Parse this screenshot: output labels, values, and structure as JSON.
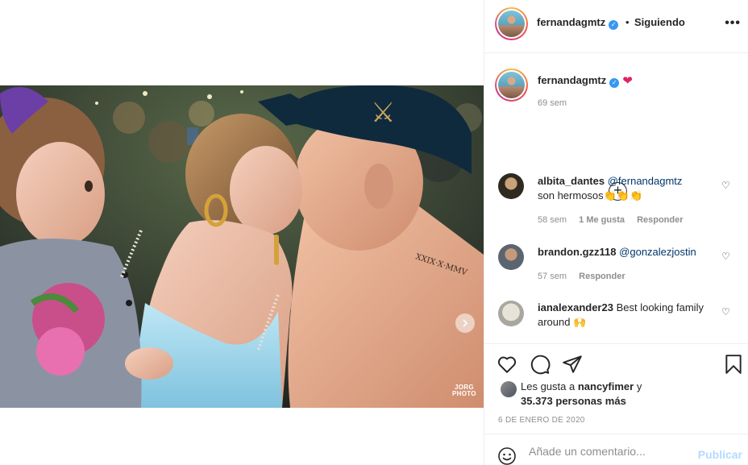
{
  "post": {
    "username": "fernandagmtz",
    "follow_status": "Siguiendo",
    "separator": "•",
    "more_icon": "more-horizontal-icon",
    "caption_emoji": "❤",
    "caption_time": "69 sem",
    "watermark_line1": "JORG",
    "watermark_line2": "PHOTO"
  },
  "comments": [
    {
      "username": "albita_dantes",
      "mention": "@fernandagmtz",
      "text": "son hermosos👏👏👏",
      "time": "58 sem",
      "likes": "1 Me gusta",
      "reply": "Responder"
    },
    {
      "username": "brandon.gzz118",
      "mention": "@gonzalezjostin",
      "text": "",
      "time": "57 sem",
      "reply": "Responder"
    },
    {
      "username": "ianalexander23",
      "text": "Best looking family around 🙌"
    }
  ],
  "likes": {
    "prefix": "Les gusta a",
    "user": "nancyfimer",
    "conjunction": "y",
    "others": "35.373 personas más"
  },
  "date": "6 DE ENERO DE 2020",
  "comment_box": {
    "placeholder": "Añade un comentario...",
    "post_label": "Publicar"
  },
  "colors": {
    "verified": "#3897f0",
    "link": "#00376b",
    "muted": "#8e8e8e",
    "post_disabled": "#b3dbff"
  }
}
